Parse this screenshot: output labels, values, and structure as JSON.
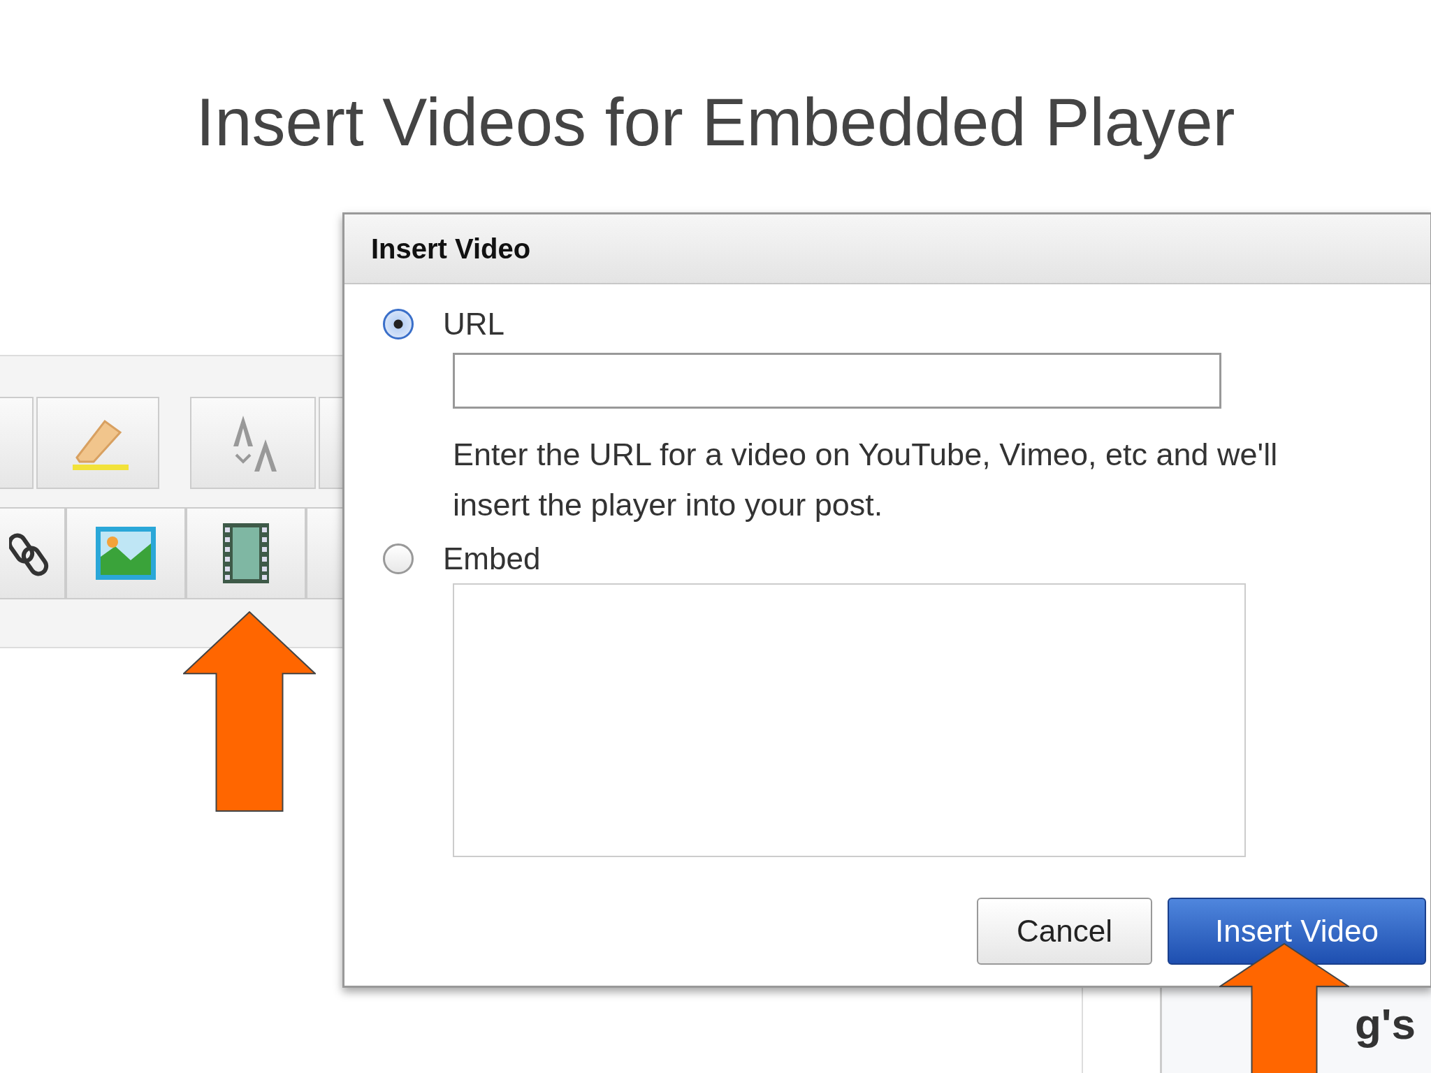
{
  "slide": {
    "title": "Insert Videos for Embedded Player"
  },
  "dialog": {
    "title": "Insert Video",
    "options": [
      {
        "label": "URL",
        "selected": true,
        "kind": "input"
      },
      {
        "label": "Embed",
        "selected": false,
        "kind": "textarea"
      }
    ],
    "help": "Enter the URL for a video on YouTube, Vimeo, etc and we'll insert the player into your post.",
    "buttons": [
      {
        "label": "Cancel",
        "kind": "secondary"
      },
      {
        "label": "Insert Video",
        "kind": "primary"
      }
    ]
  },
  "background_text": "g's"
}
